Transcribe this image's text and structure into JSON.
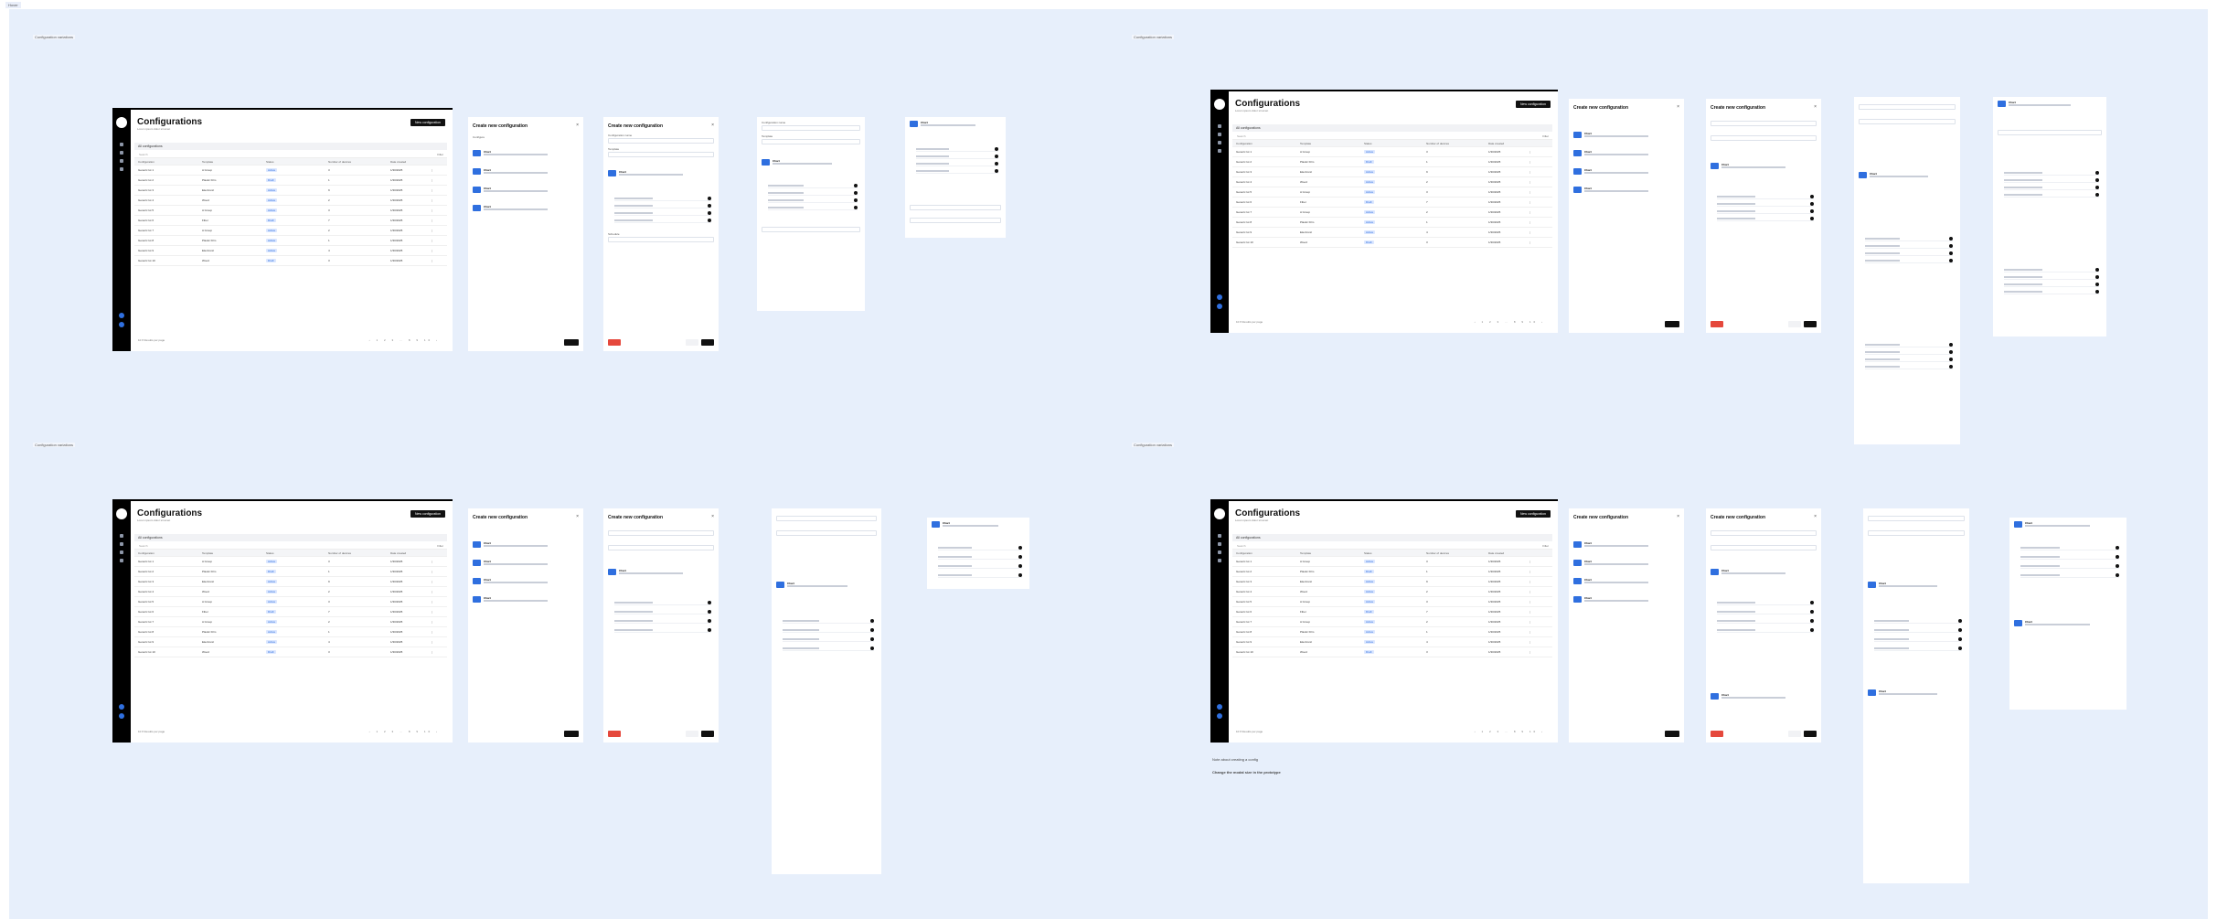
{
  "topbar": {
    "chip": "Hover"
  },
  "sections": [
    {
      "id": "q1",
      "label": "Configuration variations"
    },
    {
      "id": "q2",
      "label": "Configuration variations"
    },
    {
      "id": "q3",
      "label": "Configuration variations"
    },
    {
      "id": "q4",
      "label": "Configuration variations"
    }
  ],
  "screen": {
    "title": "Configurations",
    "subtitle": "Lorem ipsum dolor sit amet",
    "new_button": "New configuration",
    "tab": "All configurations",
    "search_placeholder": "Search",
    "filter_label": "Filter",
    "columns": [
      "Configuration",
      "Template",
      "Status",
      "Number of devices",
      "Date created",
      ""
    ],
    "rows": [
      [
        "Generic lot 1",
        "A Group",
        "Active",
        "3",
        "1/30/2025",
        "⋮"
      ],
      [
        "Generic lot 2",
        "Plastic Film",
        "Draft",
        "1",
        "1/30/2025",
        "⋮"
      ],
      [
        "Generic lot 3",
        "Electronic",
        "Active",
        "9",
        "1/30/2025",
        "⋮"
      ],
      [
        "Generic lot 4",
        "Wood",
        "Active",
        "2",
        "1/30/2025",
        "⋮"
      ],
      [
        "Generic lot 5",
        "A Group",
        "Active",
        "3",
        "1/30/2025",
        "⋮"
      ],
      [
        "Generic lot 6",
        "Fiber",
        "Draft",
        "7",
        "1/30/2025",
        "⋮"
      ],
      [
        "Generic lot 7",
        "A Group",
        "Active",
        "2",
        "1/30/2025",
        "⋮"
      ],
      [
        "Generic lot 8",
        "Plastic Film",
        "Active",
        "1",
        "1/30/2025",
        "⋮"
      ],
      [
        "Generic lot 9",
        "Electronic",
        "Active",
        "4",
        "1/30/2025",
        "⋮"
      ],
      [
        "Generic lot 10",
        "Wood",
        "Draft",
        "3",
        "1/30/2025",
        "⋮"
      ]
    ],
    "pagination": {
      "per_page": "10 ▾  Results per page",
      "pages": "‹ 1 2 3 … 8 9 10 ›"
    }
  },
  "panel": {
    "title": "Create new configuration",
    "close": "×",
    "configure_label": "Configure",
    "name_label": "Configuration name",
    "template_label": "Template",
    "schedule_label": "Schedule",
    "card_title": "Chart",
    "save_label": "Save",
    "cancel_label": "Cancel",
    "delete_label": "Delete"
  },
  "notes": {
    "line1": "Note about creating a config",
    "line2": "Change the modal size in the prototype"
  }
}
